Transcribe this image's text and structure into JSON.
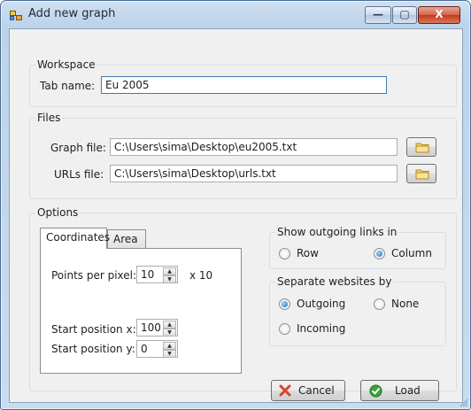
{
  "window": {
    "title": "Add new graph"
  },
  "workspace": {
    "legend": "Workspace",
    "tab_name_label": "Tab name:",
    "tab_name_value": "Eu 2005"
  },
  "files": {
    "legend": "Files",
    "graph_label": "Graph file:",
    "graph_value": "C:\\Users\\sima\\Desktop\\eu2005.txt",
    "urls_label": "URLs file:",
    "urls_value": "C:\\Users\\sima\\Desktop\\urls.txt"
  },
  "options": {
    "legend": "Options",
    "tabs": [
      {
        "label": "Coordinates"
      },
      {
        "label": "Area"
      }
    ],
    "active_tab": "Coordinates",
    "points_label": "Points per pixel:",
    "points_value": "10",
    "points_suffix": "x 10",
    "start_x_label": "Start position x:",
    "start_x_value": "100",
    "start_y_label": "Start position y:",
    "start_y_value": "0"
  },
  "outgoing": {
    "legend": "Show outgoing links in",
    "options": [
      {
        "label": "Row",
        "checked": false
      },
      {
        "label": "Column",
        "checked": true
      }
    ]
  },
  "separate": {
    "legend": "Separate websites by",
    "options": [
      {
        "label": "Outgoing",
        "checked": true
      },
      {
        "label": "None",
        "checked": false
      },
      {
        "label": "Incoming",
        "checked": false
      }
    ]
  },
  "buttons": {
    "cancel": "Cancel",
    "load": "Load"
  },
  "icons": {
    "app": "graph-window-icon",
    "folder": "folder-icon",
    "cancel": "red-x-icon",
    "load": "green-check-icon"
  },
  "colors": {
    "accent": "#3d7bad",
    "cancel_icon": "#d9432e",
    "load_icon": "#3aa33a"
  }
}
